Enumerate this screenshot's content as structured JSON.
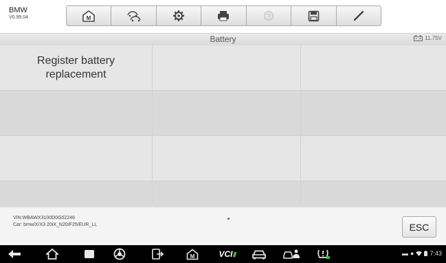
{
  "header": {
    "brand": "BMW",
    "version": "V0.99.04",
    "tools": [
      {
        "name": "home-icon"
      },
      {
        "name": "vehicle-swap-icon"
      },
      {
        "name": "settings-gear-icon"
      },
      {
        "name": "print-icon"
      },
      {
        "name": "help-icon",
        "state": "disabled"
      },
      {
        "name": "save-icon"
      },
      {
        "name": "pen-icon"
      }
    ]
  },
  "titlebar": {
    "title": "Battery",
    "voltage": "11.75V"
  },
  "grid": {
    "cells": [
      "Register battery replacement",
      "",
      "",
      "",
      "",
      "",
      "",
      "",
      "",
      "",
      "",
      ""
    ]
  },
  "footer": {
    "vin": "VIN:WBAWX3100D0G02246",
    "car": "Car: bmw/X/X3 20iX_N20/F25/EUR_LL",
    "esc_label": "ESC"
  },
  "navbar": {
    "vci_label": "VCI",
    "time": "7:43"
  },
  "colors": {
    "cell": "#e6e6e6",
    "cell_alt": "#d9d9d9",
    "accent": "#2e7bd1",
    "vci_green": "#3bbd3b"
  }
}
